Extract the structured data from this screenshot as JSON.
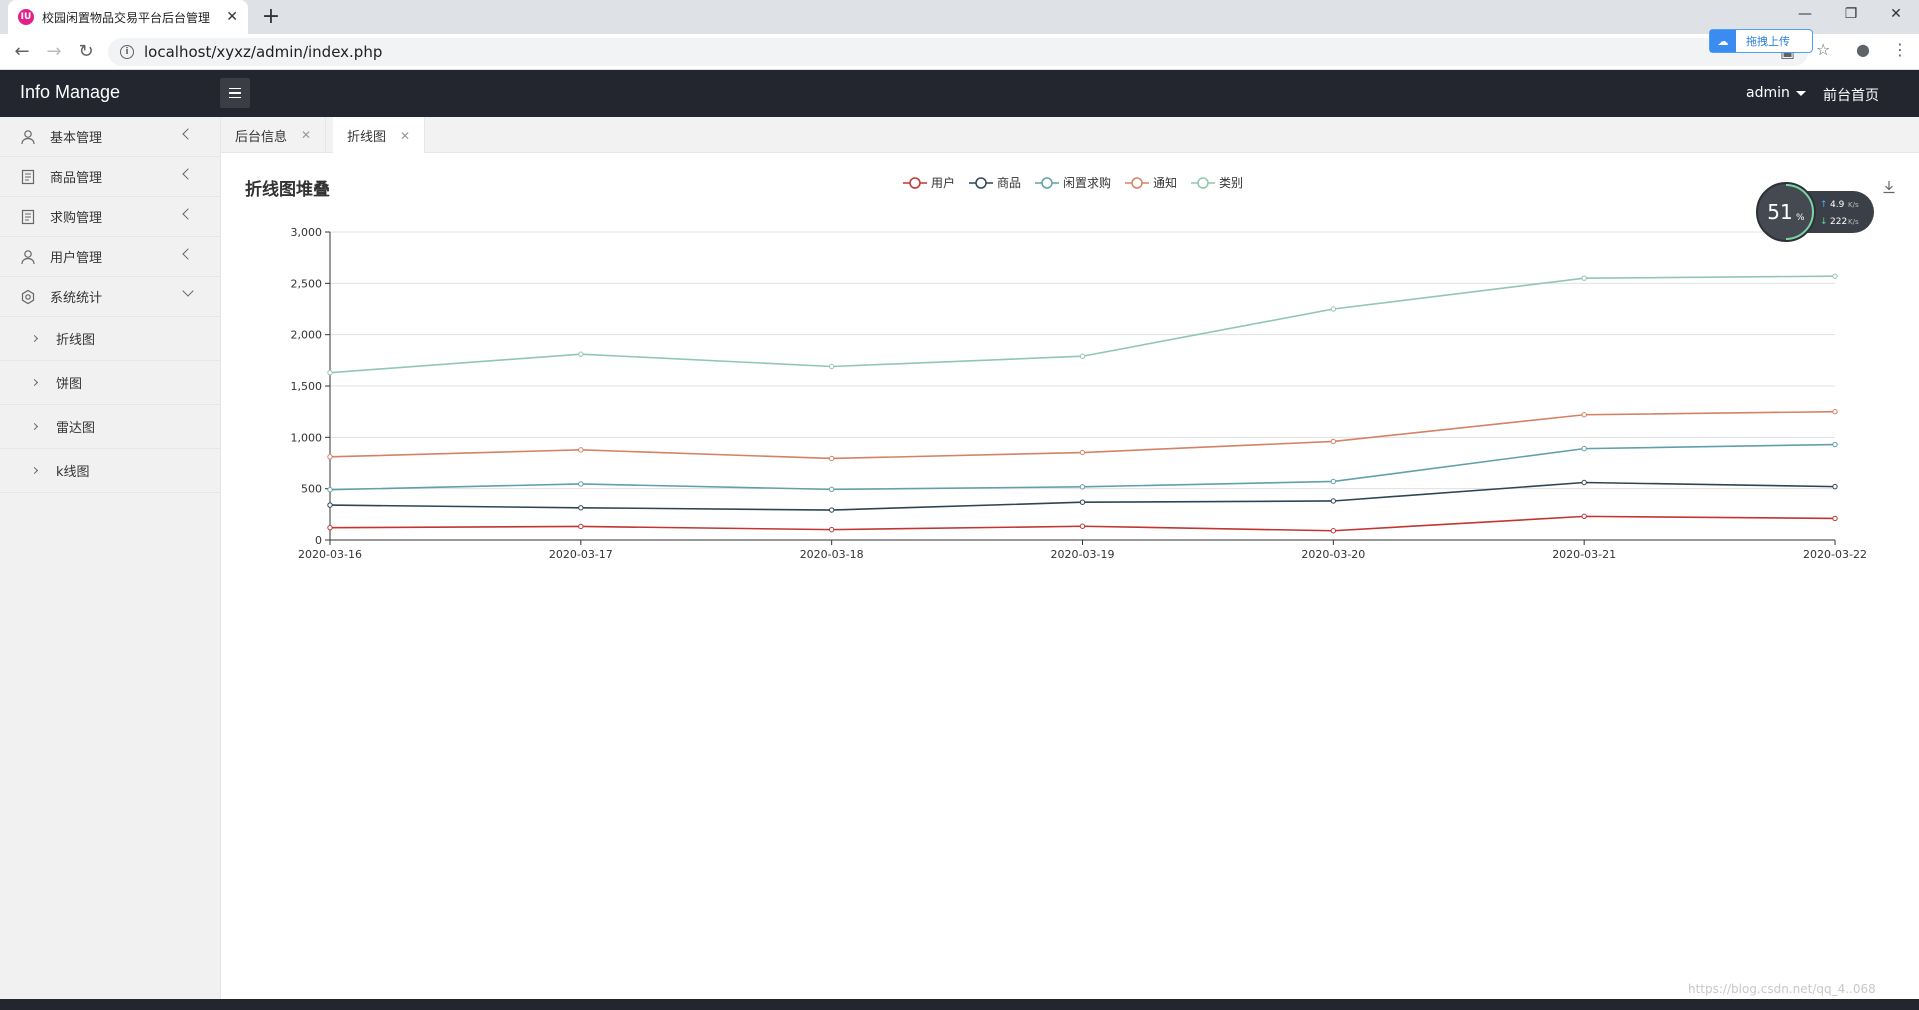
{
  "browser": {
    "tab_title": "校园闲置物品交易平台后台管理",
    "favicon_label": "IU",
    "address": "localhost/xyxz/admin/index.php",
    "upload_label": "拖拽上传"
  },
  "header": {
    "logo": "Info Manage",
    "user": "admin",
    "front_link": "前台首页"
  },
  "sidebar": {
    "items": [
      {
        "label": "基本管理",
        "icon": "user-icon"
      },
      {
        "label": "商品管理",
        "icon": "document-icon"
      },
      {
        "label": "求购管理",
        "icon": "document-icon"
      },
      {
        "label": "用户管理",
        "icon": "user-icon"
      },
      {
        "label": "系统统计",
        "icon": "settings-icon"
      }
    ],
    "sub_items": [
      {
        "label": "折线图"
      },
      {
        "label": "饼图"
      },
      {
        "label": "雷达图"
      },
      {
        "label": "k线图"
      }
    ]
  },
  "tabs": [
    {
      "label": "后台信息"
    },
    {
      "label": "折线图"
    }
  ],
  "netspeed": {
    "percent": "51",
    "percent_unit": "%",
    "up": "4.9",
    "up_unit": "K/s",
    "down": "222",
    "down_unit": "K/s"
  },
  "watermark": "https://blog.csdn.net/qq_4..068",
  "chart_data": {
    "type": "line",
    "title": "折线图堆叠",
    "categories": [
      "2020-03-16",
      "2020-03-17",
      "2020-03-18",
      "2020-03-19",
      "2020-03-20",
      "2020-03-21",
      "2020-03-22"
    ],
    "ylim": [
      0,
      3000
    ],
    "yticks": [
      "0",
      "500",
      "1,000",
      "1,500",
      "2,000",
      "2,500",
      "3,000"
    ],
    "grid": true,
    "legend_position": "top-center",
    "series": [
      {
        "name": "用户",
        "color": "#c23531",
        "values": [
          120,
          132,
          101,
          134,
          90,
          230,
          210
        ]
      },
      {
        "name": "商品",
        "color": "#2f4554",
        "values": [
          340,
          314,
          292,
          368,
          380,
          560,
          520
        ]
      },
      {
        "name": "闲置求购",
        "color": "#61a0a8",
        "values": [
          490,
          546,
          493,
          518,
          570,
          890,
          930
        ]
      },
      {
        "name": "通知",
        "color": "#d48265",
        "values": [
          810,
          878,
          794,
          852,
          960,
          1220,
          1250
        ]
      },
      {
        "name": "类别",
        "color": "#91c7ae",
        "values": [
          1630,
          1810,
          1690,
          1790,
          2250,
          2550,
          2570
        ]
      }
    ]
  }
}
